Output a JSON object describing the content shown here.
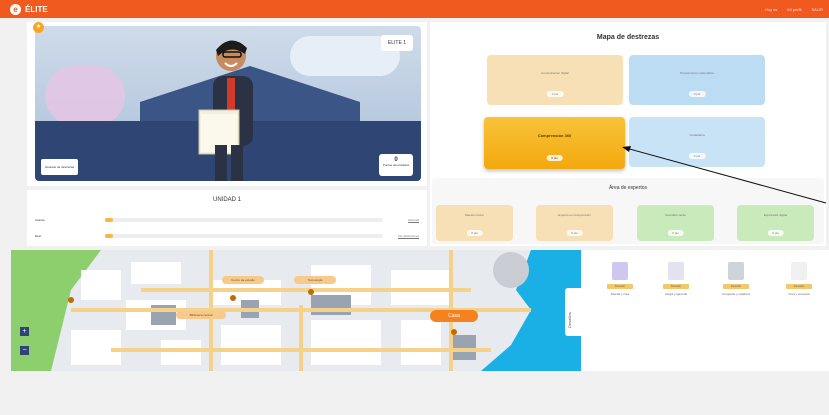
{
  "brand": {
    "name": "ÉLITE",
    "color": "#f05a1e"
  },
  "topnav": [
    "Hoy es",
    "Mi perfil",
    "SALIR"
  ],
  "hero": {
    "badge": "ELITE 1",
    "left_button": "Glosario de destrezas",
    "score_value": "0",
    "score_label": "Puntos acumulados",
    "start_marker": "★"
  },
  "unit": {
    "title": "UNIDAD 1",
    "rows": [
      {
        "label": "Avance",
        "progress": 0.02,
        "link": "Historial"
      },
      {
        "label": "Reto",
        "progress": 0.02,
        "link": "Ver distinciones"
      }
    ]
  },
  "mapa": {
    "title": "Mapa de destrezas",
    "skills": [
      {
        "name": "Comunicación digital",
        "level": "0 pts",
        "color": "#f7e0b5"
      },
      {
        "name": "Pensamiento matemático",
        "level": "0 pts",
        "color": "#bcdcf3"
      },
      {
        "name": "Comprensión 360",
        "level": "0 pts",
        "color": "#f5b31f",
        "active": true
      },
      {
        "name": "Ciudadanía",
        "level": "0 pts",
        "color": "#c9e3f6"
      }
    ],
    "experts_title": "Área de expertos",
    "experts": [
      {
        "name": "Maestro lector",
        "level": "0 pts",
        "color": "#f7e0b5"
      },
      {
        "name": "Experto en comprensión",
        "level": "0 pts",
        "color": "#f7e0b5"
      },
      {
        "name": "Guardián verde",
        "level": "0 pts",
        "color": "#c9eaba"
      },
      {
        "name": "Explorador digital",
        "level": "0 pts",
        "color": "#c9eaba"
      }
    ]
  },
  "citymap": {
    "markers": [
      "Centro de estudio",
      "Tecnología",
      "Biblioteca central",
      "Casa"
    ],
    "zoom_in": "+",
    "zoom_out": "−"
  },
  "desafios": {
    "tab": "Desafíos",
    "items": [
      {
        "label": "Diseña y crea",
        "tag": "Desafío",
        "icon": "cube-icon"
      },
      {
        "label": "Juega y aprende",
        "tag": "Desafío",
        "icon": "puzzle-icon"
      },
      {
        "label": "Comparte y colabora",
        "tag": "Desafío",
        "icon": "hand-icon"
      },
      {
        "label": "Crea y presenta",
        "tag": "Desafío",
        "icon": "paper-icon"
      }
    ]
  }
}
